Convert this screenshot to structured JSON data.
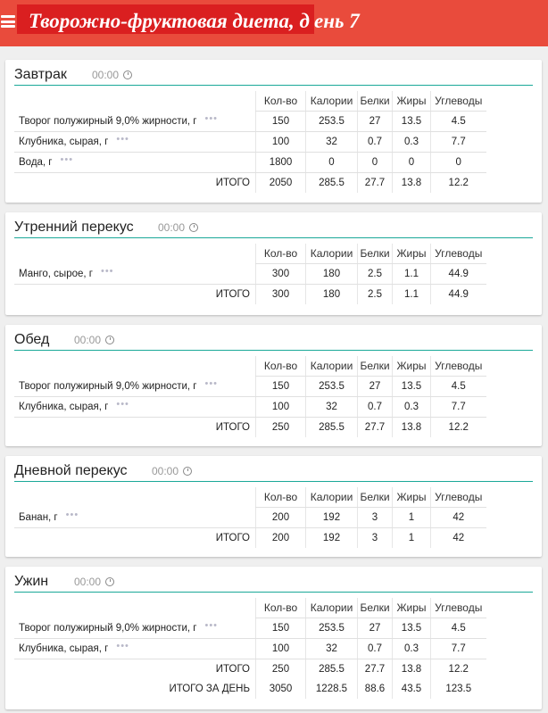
{
  "header": {
    "title_main": "Творожно-фруктовая диета, д",
    "title_tail": "ень 7"
  },
  "columns": [
    "Кол-во",
    "Калории",
    "Белки",
    "Жиры",
    "Углеводы"
  ],
  "meals": [
    {
      "name": "Завтрак",
      "time": "00:00",
      "items": [
        {
          "name": "Творог полужирный 9,0% жирности, г",
          "values": [
            "150",
            "253.5",
            "27",
            "13.5",
            "4.5"
          ]
        },
        {
          "name": "Клубника, сырая, г",
          "values": [
            "100",
            "32",
            "0.7",
            "0.3",
            "7.7"
          ]
        },
        {
          "name": "Вода, г",
          "values": [
            "1800",
            "0",
            "0",
            "0",
            "0"
          ]
        }
      ],
      "total_label": "ИТОГО",
      "total": [
        "2050",
        "285.5",
        "27.7",
        "13.8",
        "12.2"
      ]
    },
    {
      "name": "Утренний перекус",
      "time": "00:00",
      "items": [
        {
          "name": "Манго, сырое, г",
          "values": [
            "300",
            "180",
            "2.5",
            "1.1",
            "44.9"
          ]
        }
      ],
      "total_label": "ИТОГО",
      "total": [
        "300",
        "180",
        "2.5",
        "1.1",
        "44.9"
      ]
    },
    {
      "name": "Обед",
      "time": "00:00",
      "items": [
        {
          "name": "Творог полужирный 9,0% жирности, г",
          "values": [
            "150",
            "253.5",
            "27",
            "13.5",
            "4.5"
          ]
        },
        {
          "name": "Клубника, сырая, г",
          "values": [
            "100",
            "32",
            "0.7",
            "0.3",
            "7.7"
          ]
        }
      ],
      "total_label": "ИТОГО",
      "total": [
        "250",
        "285.5",
        "27.7",
        "13.8",
        "12.2"
      ]
    },
    {
      "name": "Дневной перекус",
      "time": "00:00",
      "items": [
        {
          "name": "Банан, г",
          "values": [
            "200",
            "192",
            "3",
            "1",
            "42"
          ]
        }
      ],
      "total_label": "ИТОГО",
      "total": [
        "200",
        "192",
        "3",
        "1",
        "42"
      ]
    },
    {
      "name": "Ужин",
      "time": "00:00",
      "items": [
        {
          "name": "Творог полужирный 9,0% жирности, г",
          "values": [
            "150",
            "253.5",
            "27",
            "13.5",
            "4.5"
          ]
        },
        {
          "name": "Клубника, сырая, г",
          "values": [
            "100",
            "32",
            "0.7",
            "0.3",
            "7.7"
          ]
        }
      ],
      "total_label": "ИТОГО",
      "total": [
        "250",
        "285.5",
        "27.7",
        "13.8",
        "12.2"
      ],
      "day_total_label": "ИТОГО ЗА ДЕНЬ",
      "day_total": [
        "3050",
        "1228.5",
        "88.6",
        "43.5",
        "123.5"
      ]
    }
  ],
  "icons": {
    "menu": "hamburger-menu-icon",
    "time": "clock-icon",
    "more": "more-dots-icon"
  },
  "colors": {
    "topbar": "#e94b3c",
    "title_bg": "#da1f20",
    "accent_line": "#1aa898"
  }
}
